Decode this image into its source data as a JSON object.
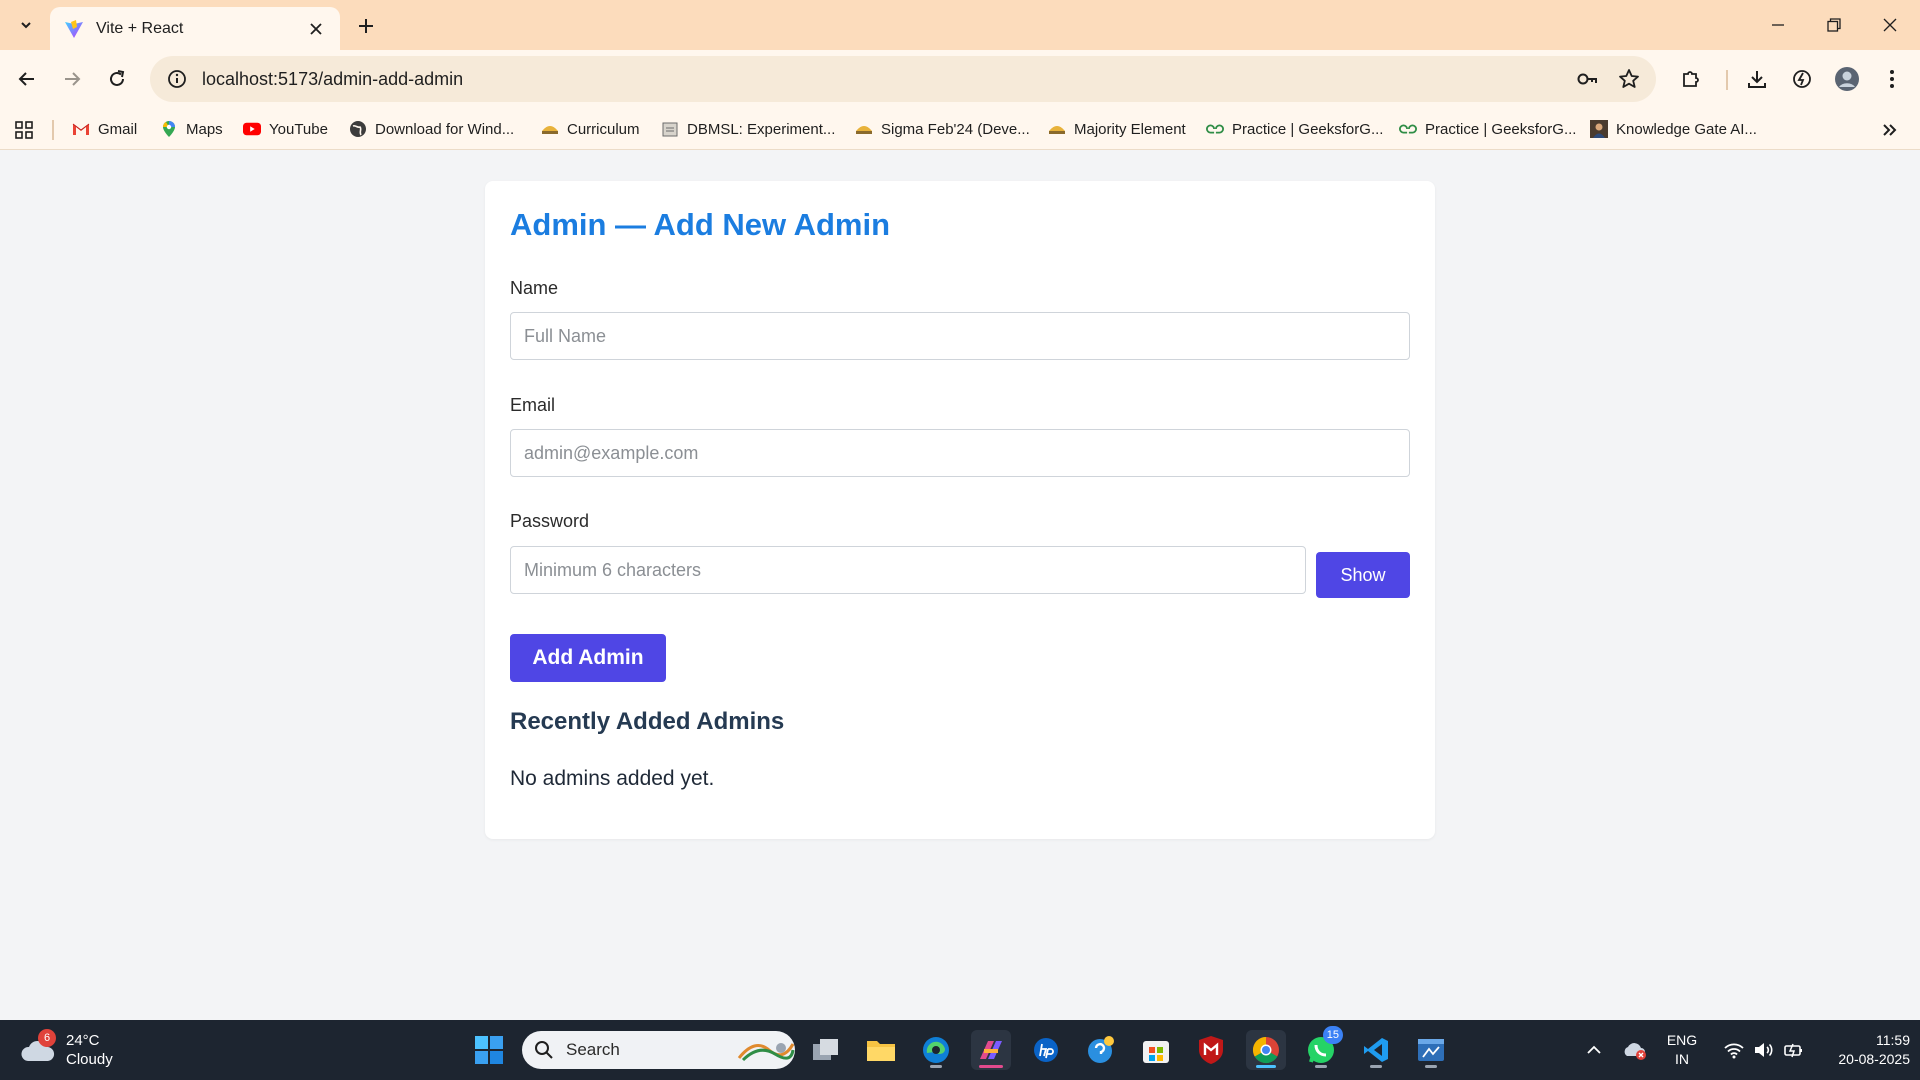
{
  "browser": {
    "tab_title": "Vite + React",
    "url": "localhost:5173/admin-add-admin"
  },
  "bookmarks": [
    {
      "label": "Gmail",
      "icon": "gmail-icon"
    },
    {
      "label": "Maps",
      "icon": "maps-icon"
    },
    {
      "label": "YouTube",
      "icon": "youtube-icon"
    },
    {
      "label": "Download for Wind...",
      "icon": "globe-icon"
    },
    {
      "label": "Curriculum",
      "icon": "course-icon"
    },
    {
      "label": "DBMSL: Experiment...",
      "icon": "doc-icon"
    },
    {
      "label": "Sigma Feb'24 (Deve...",
      "icon": "course-icon"
    },
    {
      "label": "Majority Element",
      "icon": "course-icon"
    },
    {
      "label": "Practice | GeeksforG...",
      "icon": "gfg-icon"
    },
    {
      "label": "Practice | GeeksforG...",
      "icon": "gfg-icon"
    },
    {
      "label": "Knowledge Gate AI...",
      "icon": "avatar-icon"
    }
  ],
  "form": {
    "title": "Admin — Add New Admin",
    "name_label": "Name",
    "name_placeholder": "Full Name",
    "name_value": "",
    "email_label": "Email",
    "email_placeholder": "admin@example.com",
    "email_value": "",
    "password_label": "Password",
    "password_placeholder": "Minimum 6 characters",
    "password_value": "",
    "show_label": "Show",
    "submit_label": "Add Admin"
  },
  "recent": {
    "heading": "Recently Added Admins",
    "empty_message": "No admins added yet."
  },
  "taskbar": {
    "weather_badge": "6",
    "temperature": "24°C",
    "condition": "Cloudy",
    "search_placeholder": "Search",
    "whatsapp_badge": "15",
    "language": "ENG",
    "region": "IN",
    "time": "11:59",
    "date": "20-08-2025"
  },
  "colors": {
    "accent": "#4f46e5",
    "title_blue": "#1b7de0",
    "tab_strip": "#fcdcbc",
    "page_bg": "#f3f4f6"
  }
}
